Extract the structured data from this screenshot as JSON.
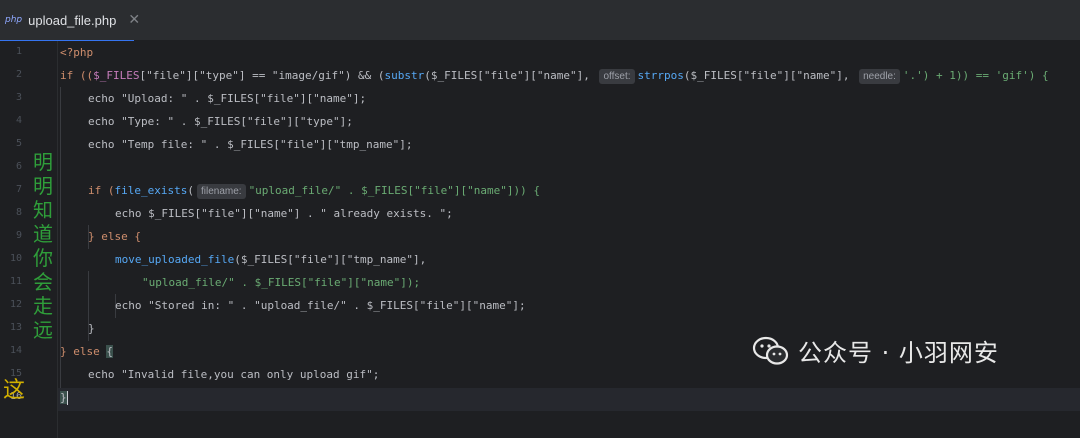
{
  "tab": {
    "icon_text": "php",
    "title": "upload_file.php",
    "close_glyph": "✕"
  },
  "gutter": {
    "line_numbers": [
      "1",
      "2",
      "3",
      "4",
      "5",
      "6",
      "7",
      "8",
      "9",
      "10",
      "11",
      "12",
      "13",
      "14",
      "15",
      "16"
    ],
    "current_line": "16"
  },
  "inlay_hints": {
    "offset": "offset:",
    "needle": "needle:",
    "filename": "filename:"
  },
  "code": {
    "l1": "<?php",
    "l2_a": "if ((",
    "l2_b": "$_FILES",
    "l2_c": "[\"file\"][\"type\"] == \"image/gif\") && (",
    "l2_d": "substr",
    "l2_e": "($_FILES[\"file\"][\"name\"], ",
    "l2_f": "strrpos",
    "l2_g": "($_FILES[\"file\"][\"name\"], ",
    "l2_h": "'.') + 1)) == 'gif') {",
    "l3": "echo \"Upload: \" . $_FILES[\"file\"][\"name\"];",
    "l4": "echo \"Type: \" . $_FILES[\"file\"][\"type\"];",
    "l5": "echo \"Temp file: \" . $_FILES[\"file\"][\"tmp_name\"];",
    "l7_a": "if (",
    "l7_b": "file_exists",
    "l7_c": "(",
    "l7_d": "\"upload_file/\" . $_FILES[\"file\"][\"name\"])) {",
    "l8": "echo $_FILES[\"file\"][\"name\"] . \" already exists. \";",
    "l9": "} else {",
    "l10_a": "move_uploaded_file",
    "l10_b": "($_FILES[\"file\"][\"tmp_name\"],",
    "l11": "\"upload_file/\" . $_FILES[\"file\"][\"name\"]);",
    "l12": "echo \"Stored in: \" . \"upload_file/\" . $_FILES[\"file\"][\"name\"];",
    "l13": "}",
    "l14_a": "} else ",
    "l14_b": "{",
    "l15": "echo \"Invalid file,you can only upload gif\";",
    "l16": "}"
  },
  "overlay": {
    "vertical_text": "明明知道你会走远",
    "bottom_char": "这"
  },
  "watermark": {
    "text": "公众号 · 小羽网安"
  },
  "colors": {
    "keyword": "#cf8e6d",
    "string": "#6aab73",
    "function": "#56a8f5",
    "variable": "#c77dbb",
    "number": "#2aacb8",
    "accent": "#3574f0"
  }
}
